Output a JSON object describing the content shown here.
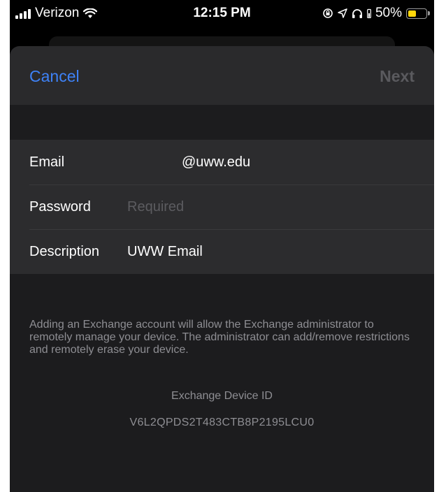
{
  "status_bar": {
    "carrier": "Verizon",
    "time": "12:15 PM",
    "battery_percent": "50%",
    "battery_level": 0.5,
    "battery_color": "#ffd60a"
  },
  "nav": {
    "cancel_label": "Cancel",
    "next_label": "Next"
  },
  "form": {
    "email": {
      "label": "Email",
      "value": "@uww.edu"
    },
    "password": {
      "label": "Password",
      "placeholder": "Required"
    },
    "description": {
      "label": "Description",
      "value": "UWW Email"
    }
  },
  "footer": {
    "notice": "Adding an Exchange account will allow the Exchange administrator to remotely manage your device. The administrator can add/remove restrictions and remotely erase your device.",
    "device_id_title": "Exchange Device ID",
    "device_id_value": "V6L2QPDS2T483CTB8P2195LCU0"
  },
  "colors": {
    "accent": "#3e82f7",
    "disabled": "#5a5a5e",
    "secondary_text": "#8e8e93"
  }
}
